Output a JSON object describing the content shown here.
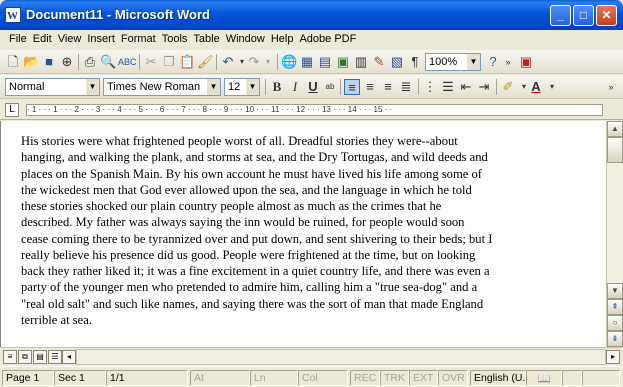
{
  "window": {
    "title": "Document11 - Microsoft Word",
    "app_icon_letter": "W",
    "minimize_glyph": "_",
    "maximize_glyph": "□",
    "close_glyph": "✕"
  },
  "menu": [
    "File",
    "Edit",
    "View",
    "Insert",
    "Format",
    "Tools",
    "Table",
    "Window",
    "Help",
    "Adobe PDF"
  ],
  "standard_toolbar": {
    "zoom": "100%"
  },
  "formatting_toolbar": {
    "style": "Normal",
    "font": "Times New Roman",
    "size": "12"
  },
  "ruler": {
    "marks": "· 1 · · · 1 · · · 2 · · · 3 · · · 4 · · · 5 · · · 6 · · · 7 · · · 8 · · · 9 · · · 10 · · · 11 · · · 12 · · · 13 · · · 14 · · · 15 · ·"
  },
  "document": {
    "lines": [
      "His stories were what frightened people worst of all. Dreadful stories they were--about",
      "hanging, and walking the plank, and storms at sea, and the Dry Tortugas, and wild deeds and",
      "places on the Spanish Main.  By his own account he must have lived his life among some of",
      "the wickedest men that God ever allowed upon the sea, and the language in which he told",
      "these stories shocked our plain country people almost as much as the crimes that he",
      "described.  My father was always saying the inn would be ruined, for people would soon",
      "cease coming there to be tyrannized over and put down, and sent shivering to their beds; but I",
      "really believe his presence did us good.  People were frightened at the time, but on looking",
      "back they rather liked it; it was a fine excitement in a quiet country life, and there was even a",
      "party of the younger men who pretended to admire him, calling him a \"true sea-dog\" and a",
      "\"real old salt\" and such like names, and saying there was the sort of man that made England",
      "terrible at sea."
    ]
  },
  "status": {
    "page": "Page 1",
    "section": "Sec 1",
    "pages": "1/1",
    "at": "At",
    "ln": "Ln",
    "col": "Col",
    "rec": "REC",
    "trk": "TRK",
    "ext": "EXT",
    "ovr": "OVR",
    "language": "English (U.K"
  }
}
